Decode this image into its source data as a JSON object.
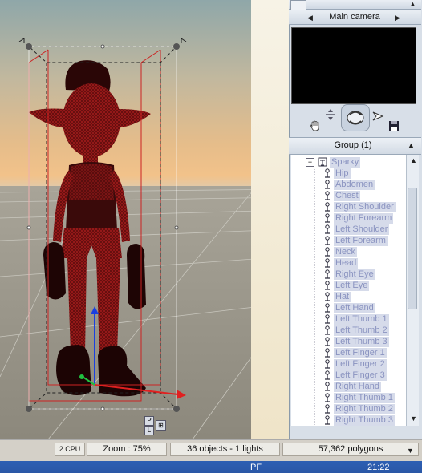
{
  "camera_panel": {
    "title": "Main camera",
    "prev_arrow": "◀",
    "next_arrow": "▶",
    "collapse_arrow": "▲"
  },
  "group_panel": {
    "title": "Group (1)",
    "collapse_arrow": "▲"
  },
  "tree": {
    "root": "Sparky",
    "items": [
      "Hip",
      "Abdomen",
      "Chest",
      "Right Shoulder",
      "Right Forearm",
      "Left Shoulder",
      "Left Forearm",
      "Neck",
      "Head",
      "Right Eye",
      "Left Eye",
      "Hat",
      "Left Hand",
      "Left Thumb 1",
      "Left Thumb 2",
      "Left Thumb 3",
      "Left Finger 1",
      "Left Finger 2",
      "Left Finger 3",
      "Right Hand",
      "Right Thumb 1",
      "Right Thumb 2",
      "Right Thumb 3"
    ]
  },
  "viewport_badges": {
    "p": "P",
    "l": "L"
  },
  "status": {
    "cpu": "2 CPU",
    "zoom": "Zoom : 75%",
    "objects": "36 objects - 1 lights",
    "polygons": "57,362 polygons"
  },
  "taskbar": {
    "lang": "PF",
    "time": "21:22"
  },
  "colors": {
    "selection_box": "#222222",
    "bounding_box_red": "#cc2222",
    "axis_x": "#e02020",
    "axis_y": "#1a3fe0",
    "axis_z": "#20c040",
    "tree_text": "#8a93c0"
  }
}
